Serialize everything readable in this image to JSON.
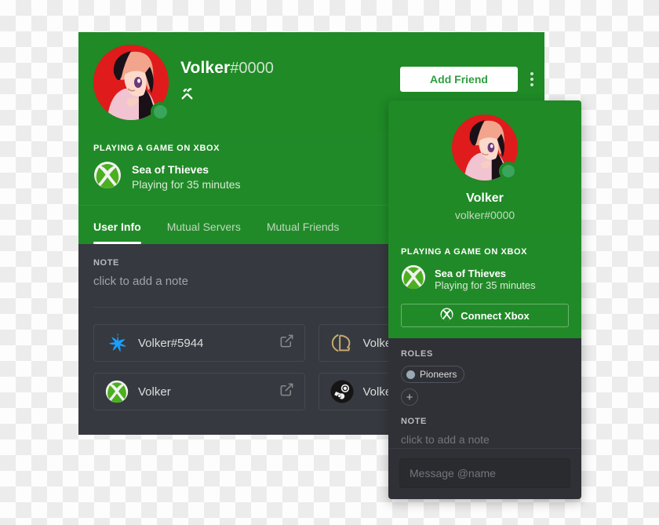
{
  "profile_card": {
    "username": "Volker",
    "discriminator": "#0000",
    "badge_icon": "hammer-and-wrench-icon",
    "status": "online",
    "avatar_alt": "anime-avatar",
    "add_friend_label": "Add Friend",
    "more_options_icon": "more-vertical-icon",
    "activity": {
      "label": "PLAYING A GAME ON XBOX",
      "platform_icon": "xbox-icon",
      "game": "Sea of Thieves",
      "elapsed": "Playing for 35 minutes"
    },
    "tabs": [
      {
        "label": "User Info",
        "active": true
      },
      {
        "label": "Mutual Servers",
        "active": false
      },
      {
        "label": "Mutual Friends",
        "active": false
      }
    ],
    "note": {
      "label": "NOTE",
      "placeholder": "click to add a note"
    },
    "connections": [
      {
        "icon": "battlenet-icon",
        "name": "Volker#5944",
        "action_icon": "external-link-icon"
      },
      {
        "icon": "league-of-legends-icon",
        "name": "Volker",
        "action_icon": "external-link-icon"
      },
      {
        "icon": "xbox-icon",
        "name": "Volker",
        "action_icon": "external-link-icon"
      },
      {
        "icon": "steam-icon",
        "name": "Volker",
        "action_icon": "external-link-icon"
      }
    ]
  },
  "popout_card": {
    "username": "Volker",
    "tag": "volker#0000",
    "status": "online",
    "avatar_alt": "anime-avatar",
    "activity": {
      "label": "PLAYING A GAME ON XBOX",
      "platform_icon": "xbox-icon",
      "game": "Sea of Thieves",
      "elapsed": "Playing for 35 minutes",
      "connect_label": "Connect Xbox",
      "connect_icon": "xbox-icon"
    },
    "roles": {
      "label": "ROLES",
      "items": [
        {
          "name": "Pioneers",
          "color": "#99aab5"
        }
      ],
      "add_label": "+"
    },
    "note": {
      "label": "NOTE",
      "placeholder": "click to add a note"
    },
    "message_placeholder": "Message @name"
  },
  "colors": {
    "header_green": "#1f8a26",
    "activity_green": "#218a28",
    "dark_bg": "#36393f",
    "popout_bg": "#2f3136",
    "online_green": "#3ba55d",
    "accent_white": "#ffffff"
  }
}
